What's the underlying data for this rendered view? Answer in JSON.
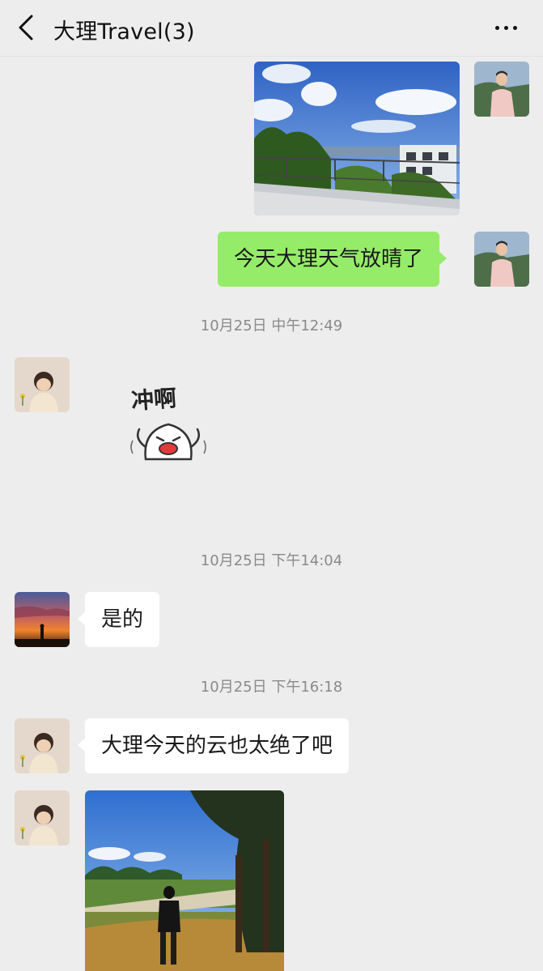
{
  "header": {
    "title": "大理Travel(3)",
    "back_icon": "chevron-left-icon",
    "more_icon": "more-dots-icon"
  },
  "messages": [
    {
      "type": "image",
      "direction": "out",
      "description": "photo"
    },
    {
      "type": "text",
      "direction": "out",
      "text": "今天大理天气放晴了"
    },
    {
      "type": "timestamp",
      "text": "10月25日 中午12:49"
    },
    {
      "type": "sticker",
      "direction": "in",
      "text": "冲啊"
    },
    {
      "type": "timestamp",
      "text": "10月25日 下午14:04"
    },
    {
      "type": "text",
      "direction": "in",
      "text": "是的"
    },
    {
      "type": "timestamp",
      "text": "10月25日 下午16:18"
    },
    {
      "type": "text",
      "direction": "in",
      "text": "大理今天的云也太绝了吧"
    },
    {
      "type": "image",
      "direction": "in",
      "description": "photo"
    }
  ],
  "colors": {
    "background": "#ededed",
    "outgoing_bubble": "#95ec69",
    "incoming_bubble": "#ffffff",
    "timestamp": "#8a8a8a"
  }
}
